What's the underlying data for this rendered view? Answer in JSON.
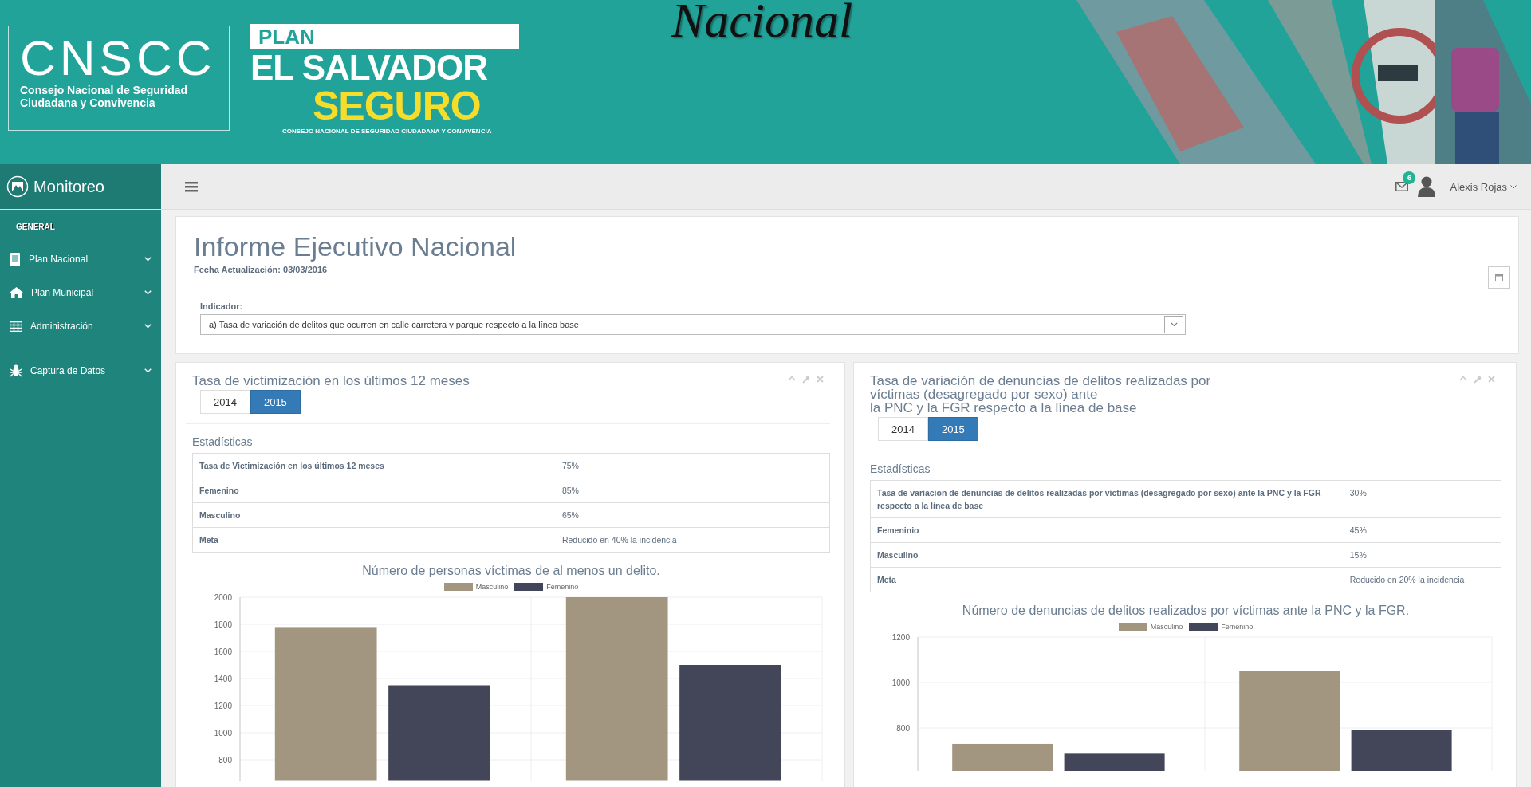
{
  "header": {
    "caption": "Nacional",
    "logo": {
      "acronym": "CNSCC",
      "line_1": "Consejo Nacional de Seguridad",
      "line_2": "Ciudadana y Convivencia"
    },
    "plan_logo": {
      "top": "PLAN",
      "middle": "EL SALVADOR",
      "bottom": "SEGURO",
      "tagline": "CONSEJO NACIONAL DE SEGURIDAD CIUDADANA Y CONVIVENCIA"
    }
  },
  "topbar": {
    "app_name": "Monitoreo",
    "notifications": "6",
    "user": "Alexis Rojas"
  },
  "sidebar": {
    "section": "GENERAL",
    "items": [
      {
        "label": "Plan Nacional",
        "kind": "building"
      },
      {
        "label": "Plan Municipal",
        "kind": "home"
      },
      {
        "label": "Administración",
        "kind": "table"
      },
      {
        "label": "Captura de Datos",
        "kind": "bug"
      }
    ]
  },
  "report": {
    "title": "Informe Ejecutivo Nacional",
    "updated": "Fecha Actualización: 03/03/2016",
    "indicator_label": "Indicador:",
    "indicator_value": "a) Tasa de variación de delitos que ocurren en calle carretera y parque respecto a la línea base"
  },
  "panels": [
    {
      "title_lines": [
        "Tasa de victimización en los últimos 12 meses"
      ],
      "years": [
        {
          "label": "2014",
          "selected": false
        },
        {
          "label": "2015",
          "selected": true
        }
      ],
      "stats_heading": "Estadísticas",
      "stats": [
        {
          "label": "Tasa de Victimización en los últimos 12 meses",
          "value": "75%"
        },
        {
          "label": "Femenino",
          "value": "85%"
        },
        {
          "label": "Masculino",
          "value": "65%"
        },
        {
          "label": "Meta",
          "value": "Reducido en 40% la incidencia"
        }
      ],
      "chart_data": {
        "type": "bar",
        "title": "Número de personas víctimas de al menos un delito.",
        "series": [
          {
            "name": "Masculino",
            "color": "#a39680",
            "values": [
              1780,
              2000
            ]
          },
          {
            "name": "Femenino",
            "color": "#434559",
            "values": [
              1350,
              1500
            ]
          }
        ],
        "ylim": [
          650,
          2000
        ],
        "yticks": [
          800,
          1000,
          1200,
          1400,
          1600,
          1800,
          2000
        ],
        "grid": true
      }
    },
    {
      "title_lines": [
        "Tasa de variación de denuncias de delitos realizadas por",
        "víctimas (desagregado por sexo) ante",
        "la PNC y la FGR respecto a la línea de base"
      ],
      "years": [
        {
          "label": "2014",
          "selected": false
        },
        {
          "label": "2015",
          "selected": true
        }
      ],
      "stats_heading": "Estadísticas",
      "stats": [
        {
          "label": "Tasa de variación de denuncias de delitos realizadas por víctimas (desagregado por sexo) ante la PNC y la FGR respecto a la línea de base",
          "value": "30%"
        },
        {
          "label": "Femeninio",
          "value": "45%"
        },
        {
          "label": "Masculino",
          "value": "15%"
        },
        {
          "label": "Meta",
          "value": "Reducido en 20% la incidencia"
        }
      ],
      "chart_data": {
        "type": "bar",
        "title": "Número de denuncias de delitos realizados por víctimas ante la PNC y la FGR.",
        "series": [
          {
            "name": "Masculino",
            "color": "#a39680",
            "values": [
              730,
              1050
            ]
          },
          {
            "name": "Femenino",
            "color": "#434559",
            "values": [
              690,
              790
            ]
          }
        ],
        "ylim": [
          610,
          1200
        ],
        "yticks": [
          800,
          1000,
          1200
        ],
        "grid": true
      }
    }
  ]
}
